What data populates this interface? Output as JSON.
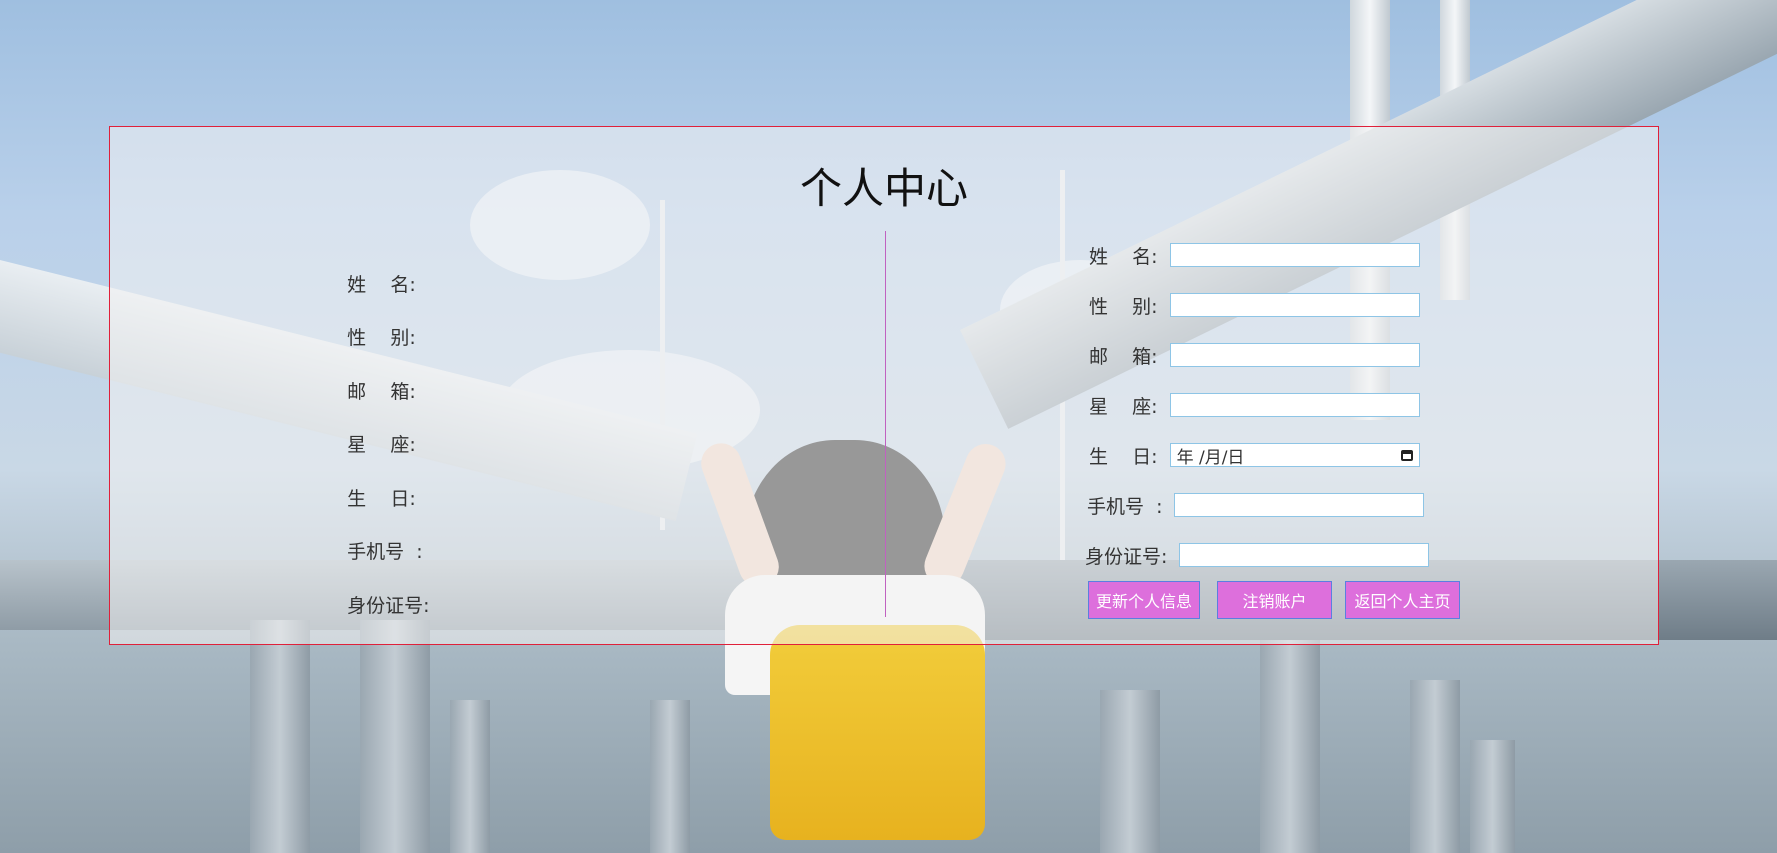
{
  "page": {
    "title": "个人中心"
  },
  "info": {
    "name_label": "姓    名:",
    "name_value": "",
    "gender_label": "性    别:",
    "gender_value": "",
    "email_label": "邮    箱:",
    "email_value": "",
    "zodiac_label": "星    座:",
    "zodiac_value": "",
    "birthday_label": "生    日:",
    "birthday_value": "",
    "phone_label": "手机号  :",
    "phone_value": "",
    "idcard_label": "身份证号:",
    "idcard_value": ""
  },
  "form": {
    "name_label": "姓    名:",
    "name_value": "",
    "gender_label": "性    别:",
    "gender_value": "",
    "email_label": "邮    箱:",
    "email_value": "",
    "zodiac_label": "星    座:",
    "zodiac_value": "",
    "birthday_label": "生    日:",
    "birthday_placeholder": "年 /月/日",
    "phone_label": "手机号  :",
    "phone_value": "",
    "idcard_label": "身份证号:",
    "idcard_value": ""
  },
  "buttons": {
    "update_label": "更新个人信息",
    "deactivate_label": "注销账户",
    "home_label": "返回个人主页"
  },
  "colors": {
    "panel_border": "#e0203a",
    "divider": "#c062c0",
    "button_bg": "#dd6fdc",
    "button_border": "#5b7fe0",
    "input_border": "#8ec5e6"
  }
}
